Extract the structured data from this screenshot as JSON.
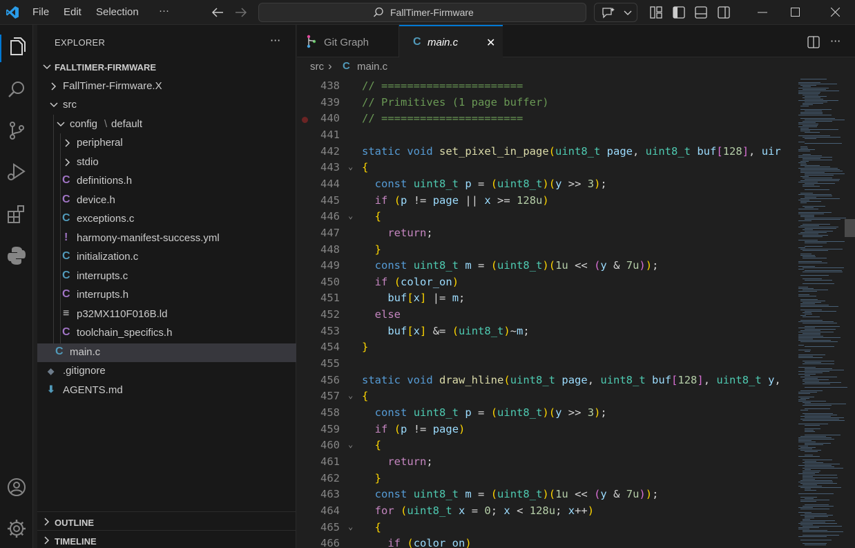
{
  "titlebar": {
    "menu": [
      "File",
      "Edit",
      "Selection",
      "···"
    ],
    "search_text": "FallTimer-Firmware",
    "icons": [
      "vscode-logo-icon",
      "back-arrow-icon",
      "forward-arrow-icon",
      "search-icon",
      "copilot-chat-icon",
      "chevron-down-icon",
      "customize-layout-icon",
      "toggle-primary-sidebar-icon",
      "toggle-panel-icon",
      "toggle-secondary-sidebar-icon",
      "minimize-icon",
      "maximize-icon",
      "close-icon"
    ]
  },
  "activity": [
    "explorer-icon",
    "search-icon",
    "source-control-icon",
    "run-debug-icon",
    "extensions-icon",
    "python-icon",
    "account-icon",
    "settings-gear-icon"
  ],
  "sidebar": {
    "title": "EXPLORER",
    "more": "···",
    "root": "FALLTIMER-FIRMWARE",
    "items": [
      {
        "label": "FallTimer-Firmware.X",
        "icon": "",
        "kind": "folder-closed"
      },
      {
        "label": "src",
        "icon": "",
        "kind": "folder-open"
      },
      {
        "label": "config",
        "label2": "default",
        "icon": "",
        "kind": "folder-open"
      },
      {
        "label": "peripheral",
        "icon": "",
        "kind": "folder-closed"
      },
      {
        "label": "stdio",
        "icon": "",
        "kind": "folder-closed"
      },
      {
        "label": "definitions.h",
        "icon": "C",
        "kind": "h"
      },
      {
        "label": "device.h",
        "icon": "C",
        "kind": "h"
      },
      {
        "label": "exceptions.c",
        "icon": "C",
        "kind": "c"
      },
      {
        "label": "harmony-manifest-success.yml",
        "icon": "!",
        "kind": "yml"
      },
      {
        "label": "initialization.c",
        "icon": "C",
        "kind": "c"
      },
      {
        "label": "interrupts.c",
        "icon": "C",
        "kind": "c"
      },
      {
        "label": "interrupts.h",
        "icon": "C",
        "kind": "h"
      },
      {
        "label": "p32MX110F016B.ld",
        "icon": "≡",
        "kind": "ld"
      },
      {
        "label": "toolchain_specifics.h",
        "icon": "C",
        "kind": "h"
      },
      {
        "label": "main.c",
        "icon": "C",
        "kind": "c"
      },
      {
        "label": ".gitignore",
        "icon": "◆",
        "kind": "git"
      },
      {
        "label": "AGENTS.md",
        "icon": "⬇",
        "kind": "md"
      }
    ],
    "outline": "OUTLINE",
    "timeline": "TIMELINE"
  },
  "editor": {
    "tabs": [
      {
        "label": "Git Graph"
      },
      {
        "label": "main.c",
        "close": "✕"
      }
    ],
    "breadcrumb": {
      "folder": "src",
      "sep": "›",
      "file": "main.c",
      "icon": "C"
    },
    "lines": [
      {
        "n": "438",
        "t": "// ======================"
      },
      {
        "n": "439",
        "t": "// Primitives (1 page buffer)"
      },
      {
        "n": "440",
        "t": "// ======================"
      },
      {
        "n": "441",
        "t": ""
      },
      {
        "n": "442",
        "t": "static void set_pixel_in_page(uint8_t page, uint8_t buf[128], uir"
      },
      {
        "n": "443",
        "t": "{"
      },
      {
        "n": "444",
        "t": "  const uint8_t p = (uint8_t)(y >> 3);"
      },
      {
        "n": "445",
        "t": "  if (p != page || x >= 128u)"
      },
      {
        "n": "446",
        "t": "  {"
      },
      {
        "n": "447",
        "t": "    return;"
      },
      {
        "n": "448",
        "t": "  }"
      },
      {
        "n": "449",
        "t": "  const uint8_t m = (uint8_t)(1u << (y & 7u));"
      },
      {
        "n": "450",
        "t": "  if (color_on)"
      },
      {
        "n": "451",
        "t": "    buf[x] |= m;"
      },
      {
        "n": "452",
        "t": "  else"
      },
      {
        "n": "453",
        "t": "    buf[x] &= (uint8_t)~m;"
      },
      {
        "n": "454",
        "t": "}"
      },
      {
        "n": "455",
        "t": ""
      },
      {
        "n": "456",
        "t": "static void draw_hline(uint8_t page, uint8_t buf[128], uint8_t y,"
      },
      {
        "n": "457",
        "t": "{"
      },
      {
        "n": "458",
        "t": "  const uint8_t p = (uint8_t)(y >> 3);"
      },
      {
        "n": "459",
        "t": "  if (p != page)"
      },
      {
        "n": "460",
        "t": "  {"
      },
      {
        "n": "461",
        "t": "    return;"
      },
      {
        "n": "462",
        "t": "  }"
      },
      {
        "n": "463",
        "t": "  const uint8_t m = (uint8_t)(1u << (y & 7u));"
      },
      {
        "n": "464",
        "t": "  for (uint8_t x = 0; x < 128u; x++)"
      },
      {
        "n": "465",
        "t": "  {"
      },
      {
        "n": "466",
        "t": "    if (color_on)"
      }
    ]
  }
}
